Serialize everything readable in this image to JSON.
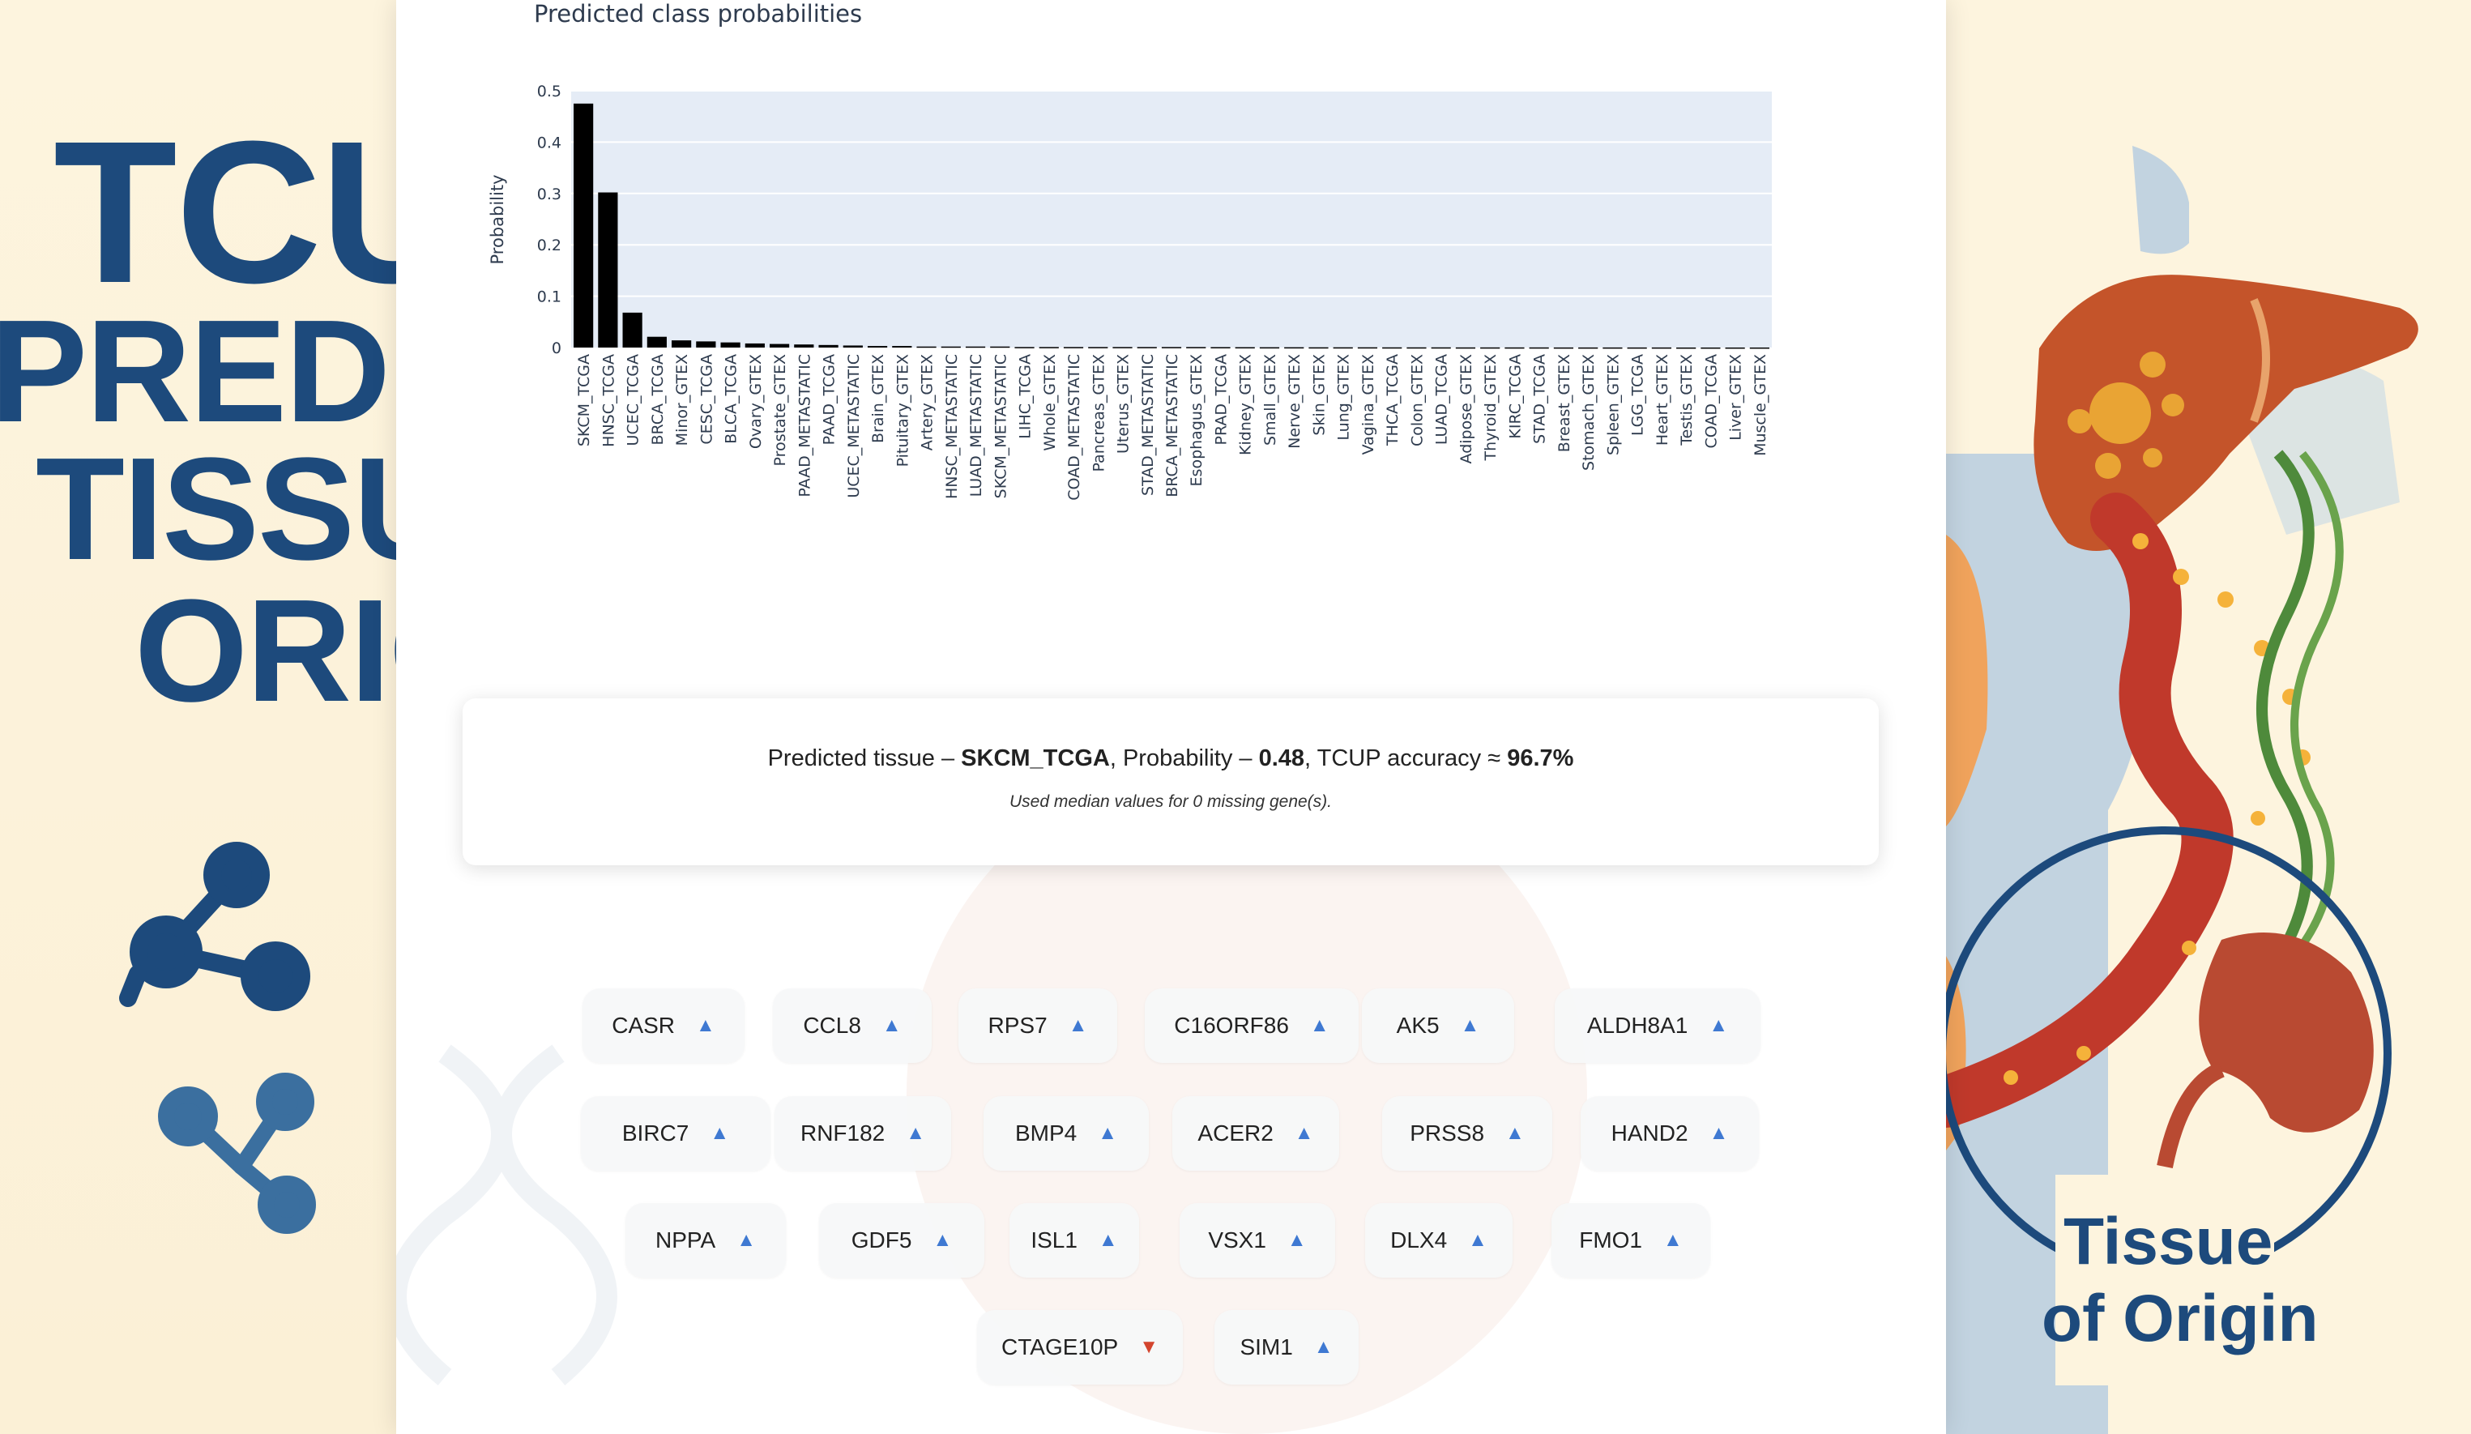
{
  "banner": {
    "line1": "TCUP",
    "line2": "PREDICTS",
    "line3": "TISSUE OF",
    "line4": "ORIGIN",
    "tagline_1": "Tissue",
    "tagline_2": "of Origin"
  },
  "result": {
    "prefix": "Predicted tissue – ",
    "tissue": "SKCM_TCGA",
    "prob_prefix": ", Probability – ",
    "probability": "0.48",
    "acc_prefix": ", TCUP accuracy ≈ ",
    "accuracy": "96.7%",
    "note": "Used median values for 0 missing gene(s)."
  },
  "genes": [
    {
      "name": "CASR",
      "dir": "up",
      "arrow": "▲"
    },
    {
      "name": "CCL8",
      "dir": "up",
      "arrow": "▲"
    },
    {
      "name": "RPS7",
      "dir": "up",
      "arrow": "▲"
    },
    {
      "name": "C16ORF86",
      "dir": "up",
      "arrow": "▲"
    },
    {
      "name": "AK5",
      "dir": "up",
      "arrow": "▲"
    },
    {
      "name": "ALDH8A1",
      "dir": "up",
      "arrow": "▲"
    },
    {
      "name": "BIRC7",
      "dir": "up",
      "arrow": "▲"
    },
    {
      "name": "RNF182",
      "dir": "up",
      "arrow": "▲"
    },
    {
      "name": "BMP4",
      "dir": "up",
      "arrow": "▲"
    },
    {
      "name": "ACER2",
      "dir": "up",
      "arrow": "▲"
    },
    {
      "name": "PRSS8",
      "dir": "up",
      "arrow": "▲"
    },
    {
      "name": "HAND2",
      "dir": "up",
      "arrow": "▲"
    },
    {
      "name": "NPPA",
      "dir": "up",
      "arrow": "▲"
    },
    {
      "name": "GDF5",
      "dir": "up",
      "arrow": "▲"
    },
    {
      "name": "ISL1",
      "dir": "up",
      "arrow": "▲"
    },
    {
      "name": "VSX1",
      "dir": "up",
      "arrow": "▲"
    },
    {
      "name": "DLX4",
      "dir": "up",
      "arrow": "▲"
    },
    {
      "name": "FMO1",
      "dir": "up",
      "arrow": "▲"
    },
    {
      "name": "CTAGE10P",
      "dir": "down",
      "arrow": "▼"
    },
    {
      "name": "SIM1",
      "dir": "up",
      "arrow": "▲"
    }
  ],
  "colors": {
    "bar": "#000000",
    "plot_bg": "#e5ecf6",
    "up_arrow": "#3f79d2",
    "down_arrow": "#d3452e",
    "banner_text": "#1d4a7c"
  },
  "chart_data": {
    "type": "bar",
    "title": "Predicted class probabilities",
    "xlabel": "",
    "ylabel": "Probability",
    "ylim": [
      0,
      0.5
    ],
    "yticks": [
      0,
      0.1,
      0.2,
      0.3,
      0.4,
      0.5
    ],
    "ytick_labels": [
      "0",
      "0.1",
      "0.2",
      "0.3",
      "0.4",
      "0.5"
    ],
    "grid": true,
    "categories": [
      "SKCM_TCGA",
      "HNSC_TCGA",
      "UCEC_TCGA",
      "BRCA_TCGA",
      "Minor_GTEX",
      "CESC_TCGA",
      "BLCA_TCGA",
      "Ovary_GTEX",
      "Prostate_GTEX",
      "PAAD_METASTATIC",
      "PAAD_TCGA",
      "UCEC_METASTATIC",
      "Brain_GTEX",
      "Pituitary_GTEX",
      "Artery_GTEX",
      "HNSC_METASTATIC",
      "LUAD_METASTATIC",
      "SKCM_METASTATIC",
      "LIHC_TCGA",
      "Whole_GTEX",
      "COAD_METASTATIC",
      "Pancreas_GTEX",
      "Uterus_GTEX",
      "STAD_METASTATIC",
      "BRCA_METASTATIC",
      "Esophagus_GTEX",
      "PRAD_TCGA",
      "Kidney_GTEX",
      "Small_GTEX",
      "Nerve_GTEX",
      "Skin_GTEX",
      "Lung_GTEX",
      "Vagina_GTEX",
      "THCA_TCGA",
      "Colon_GTEX",
      "LUAD_TCGA",
      "Adipose_GTEX",
      "Thyroid_GTEX",
      "KIRC_TCGA",
      "STAD_TCGA",
      "Breast_GTEX",
      "Stomach_GTEX",
      "Spleen_GTEX",
      "LGG_TCGA",
      "Heart_GTEX",
      "Testis_GTEX",
      "COAD_TCGA",
      "Liver_GTEX",
      "Muscle_GTEX"
    ],
    "values": [
      0.475,
      0.302,
      0.068,
      0.021,
      0.014,
      0.012,
      0.01,
      0.008,
      0.007,
      0.006,
      0.005,
      0.004,
      0.003,
      0.003,
      0.002,
      0.002,
      0.002,
      0.002,
      0.001,
      0.001,
      0.001,
      0.001,
      0.001,
      0.001,
      0.001,
      0.001,
      0.0008,
      0.0007,
      0.0006,
      0.0006,
      0.0005,
      0.0005,
      0.0005,
      0.0004,
      0.0004,
      0.0004,
      0.0003,
      0.0003,
      0.0003,
      0.0003,
      0.0002,
      0.0002,
      0.0002,
      0.0002,
      0.0002,
      0.0001,
      0.0001,
      0.0001,
      0.0001
    ]
  }
}
